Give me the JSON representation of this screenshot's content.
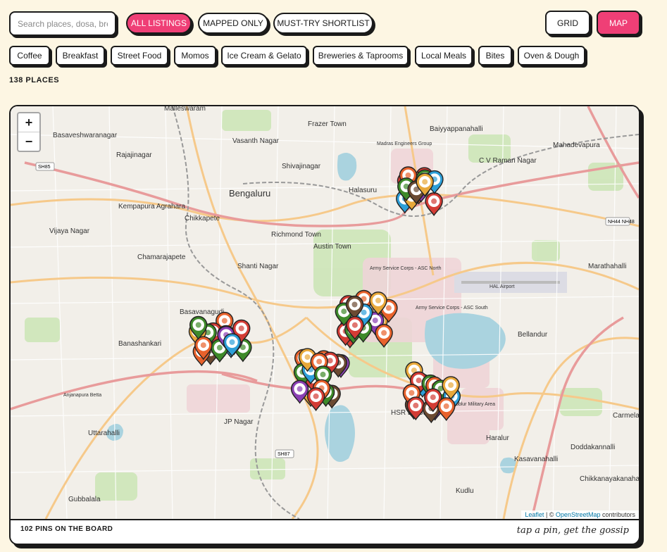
{
  "search": {
    "placeholder": "Search places, dosa, brews…"
  },
  "view_filters": [
    {
      "label": "ALL LISTINGS",
      "active": true
    },
    {
      "label": "MAPPED ONLY",
      "active": false
    },
    {
      "label": "MUST-TRY SHORTLIST",
      "active": false
    }
  ],
  "view_modes": [
    {
      "label": "GRID",
      "active": false
    },
    {
      "label": "MAP",
      "active": true
    }
  ],
  "categories": [
    "Coffee",
    "Breakfast",
    "Street Food",
    "Momos",
    "Ice Cream & Gelato",
    "Breweries & Taprooms",
    "Local Meals",
    "Bites",
    "Oven & Dough"
  ],
  "places_count": "138 PLACES",
  "map": {
    "zoom_in": "+",
    "zoom_out": "−",
    "attribution": {
      "leaflet": "Leaflet",
      "sep": " | © ",
      "osm": "OpenStreetMap",
      "suffix": " contributors"
    },
    "labels": [
      "Malleswaram",
      "Frazer Town",
      "Basaveshwaranagar",
      "Rajajinagar",
      "Vasanth Nagar",
      "Shivajinagar",
      "Baiyyappanahalli",
      "Mahadevapura",
      "C V Raman Nagar",
      "Bengaluru",
      "Halasuru",
      "Kempapura Agrahara",
      "Chikkapete",
      "Vijaya Nagar",
      "Richmond Town",
      "Austin Town",
      "Chamarajapete",
      "Shanti Nagar",
      "Marathahalli",
      "Basavanagudi",
      "Bellandur",
      "Banashankari",
      "HSR Layout",
      "JP Nagar",
      "Uttarahalli",
      "Haralur",
      "Doddakannalli",
      "Carmela",
      "Kasavanahalli",
      "Kudlu",
      "Chikkanayakanahalli",
      "Gubbalala",
      "Madras Engineers Group",
      "HAL Airport",
      "Army Service Corps - ASC North",
      "Army Service Corps - ASC South",
      "Anjanapura Betta",
      "Ibblur Military Area"
    ],
    "road_shields": [
      "SH85",
      "NH44 NH48",
      "SH87"
    ]
  },
  "pin_colors": {
    "orange": "#e8622c",
    "red": "#d33c35",
    "green": "#3e8a2a",
    "blue": "#2d9fd8",
    "brown": "#6b4a32",
    "yellow": "#e8a83a",
    "purple": "#8a3fb3"
  },
  "footer": {
    "pins": "102 PINS ON THE BOARD",
    "tagline": "tap a pin, get the gossip"
  }
}
